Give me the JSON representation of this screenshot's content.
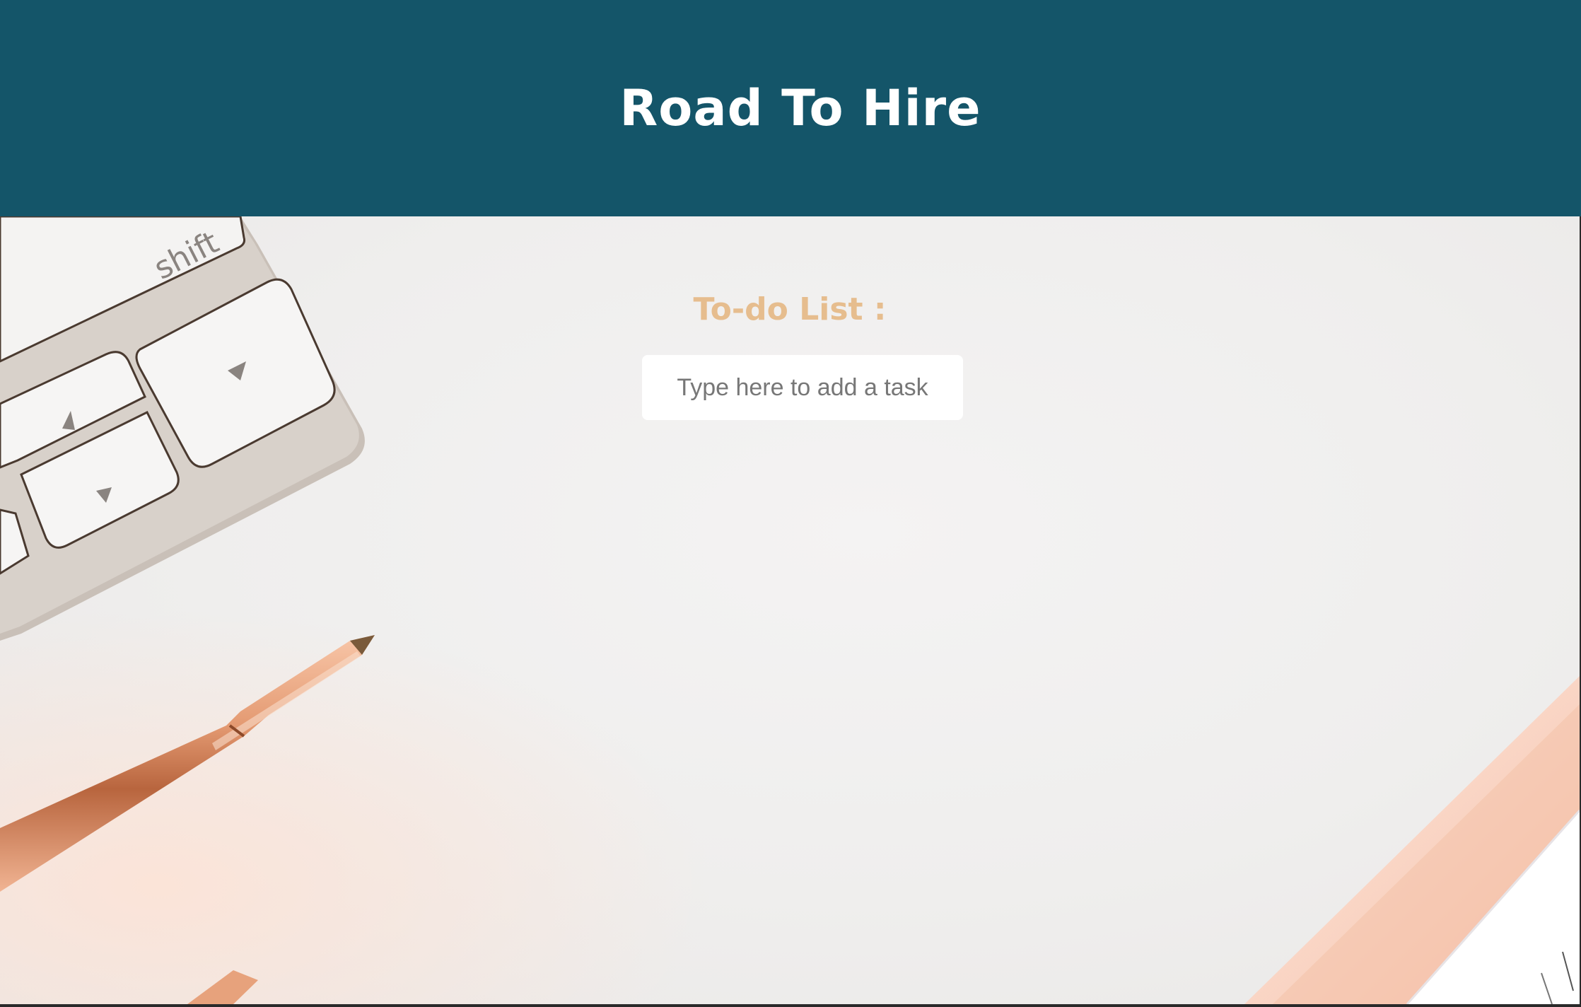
{
  "header": {
    "title": "Road To Hire",
    "background": "#145569"
  },
  "todo": {
    "heading": "To-do List :",
    "heading_color": "#e6bd8e",
    "input_placeholder": "Type here to add a task",
    "input_value": ""
  },
  "background_photo": {
    "keyboard_key_label": "shift"
  }
}
